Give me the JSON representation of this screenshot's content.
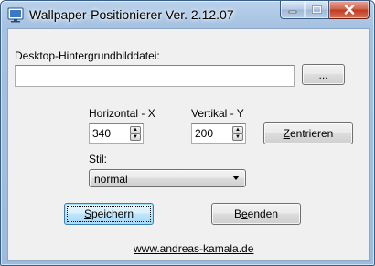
{
  "window": {
    "title": "Wallpaper-Positionierer Ver. 2.12.07"
  },
  "caption": {
    "minimize_icon": "minimize-icon",
    "maximize_icon": "maximize-icon",
    "close_icon": "close-icon"
  },
  "file": {
    "label": "Desktop-Hintergrundbilddatei:",
    "value": "",
    "browse_label": "..."
  },
  "horizontal": {
    "label": "Horizontal - X",
    "value": "340"
  },
  "vertical": {
    "label": "Vertikal - Y",
    "value": "200"
  },
  "center_button": {
    "underline_char": "Z",
    "rest": "entrieren"
  },
  "style": {
    "label": "Stil:",
    "selected": "normal"
  },
  "save_button": {
    "underline_char": "S",
    "rest": "peichern"
  },
  "quit_button": {
    "prefix": "B",
    "underline_char": "e",
    "rest": "enden"
  },
  "website": {
    "link": "www.andreas-kamala.de"
  },
  "colors": {
    "title_bar": "#a6c2e2",
    "close_button": "#c0391f",
    "client_background": "#f0f0f0"
  }
}
